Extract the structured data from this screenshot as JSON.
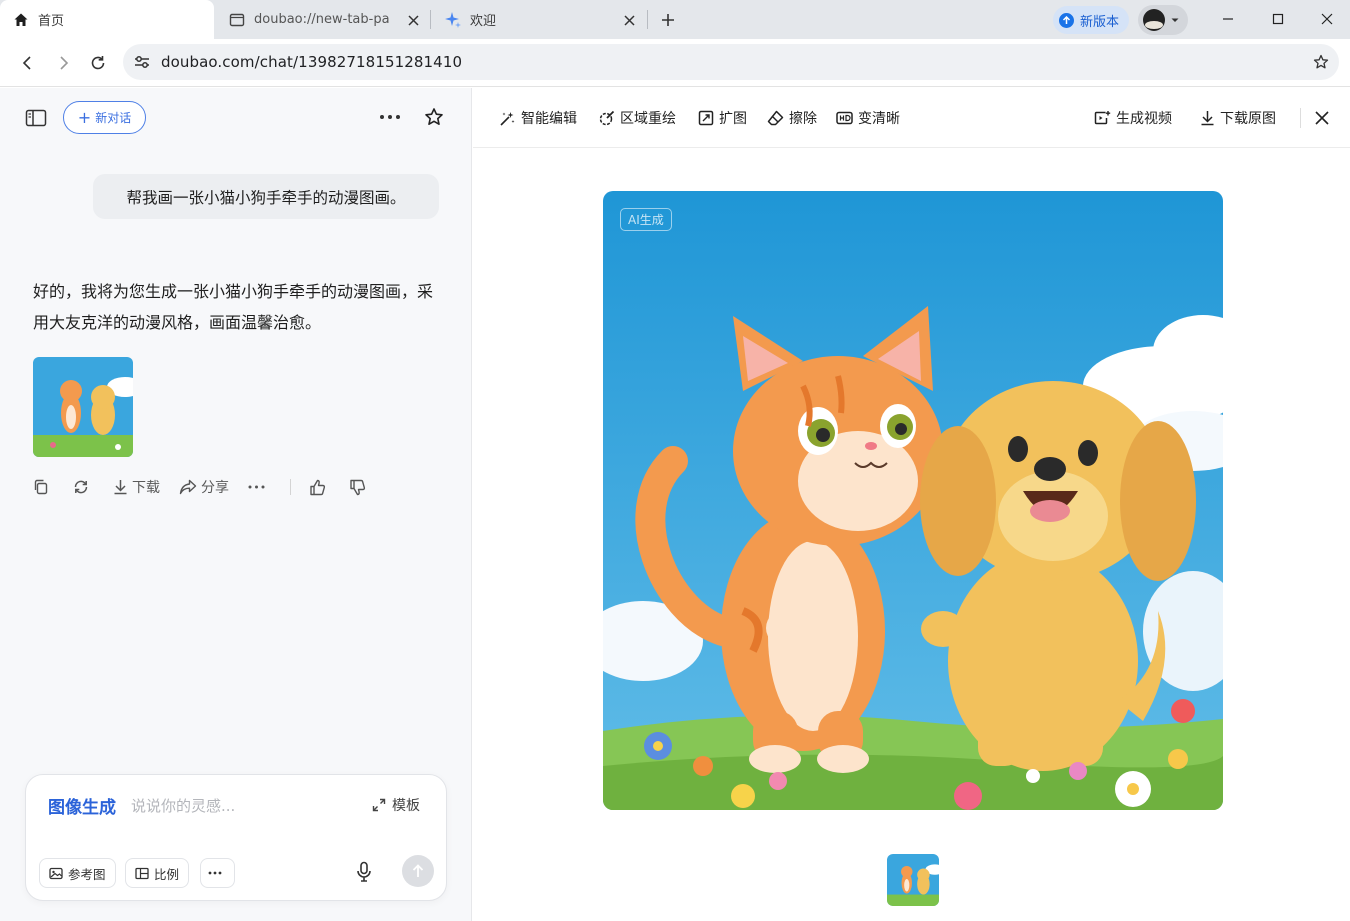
{
  "browser": {
    "tabs": [
      {
        "title": "首页",
        "icon": "home-icon",
        "active": true
      },
      {
        "title": "doubao://new-tab-pa",
        "icon": "page-icon",
        "active": false
      },
      {
        "title": "欢迎",
        "icon": "sparkle-icon",
        "active": false
      }
    ],
    "new_version_label": "新版本",
    "url": "doubao.com/chat/13982718151281410"
  },
  "chat": {
    "new_chat_label": "新对话",
    "user_message": "帮我画一张小猫小狗手牵手的动漫图画。",
    "ai_message": "好的，我将为您生成一张小猫小狗手牵手的动漫图画，采用大友克洋的动漫风格，画面温馨治愈。",
    "actions": {
      "download": "下载",
      "share": "分享"
    },
    "composer": {
      "mode": "图像生成",
      "placeholder": "说说你的灵感...",
      "template": "模板",
      "reference_image": "参考图",
      "ratio": "比例"
    }
  },
  "viewer": {
    "tools": [
      "智能编辑",
      "区域重绘",
      "扩图",
      "擦除",
      "变清晰"
    ],
    "generate_video": "生成视频",
    "download_original": "下载原图",
    "ai_badge": "AI生成"
  },
  "colors": {
    "accent": "#2b63d9",
    "sky": "#2f9fd8",
    "grass": "#7cc24a",
    "cat": "#f39a4e",
    "dog": "#f2c15c"
  }
}
